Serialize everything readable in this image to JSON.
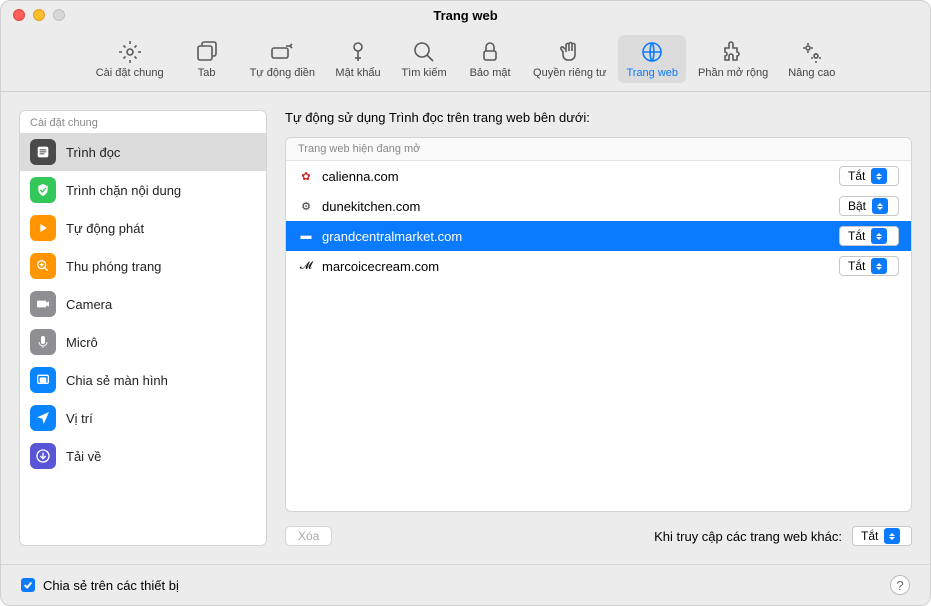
{
  "window": {
    "title": "Trang web"
  },
  "toolbar": {
    "items": [
      {
        "label": "Cài đặt chung",
        "icon": "gear"
      },
      {
        "label": "Tab",
        "icon": "tabs"
      },
      {
        "label": "Tự động điền",
        "icon": "autofill"
      },
      {
        "label": "Mật khẩu",
        "icon": "key"
      },
      {
        "label": "Tìm kiếm",
        "icon": "search"
      },
      {
        "label": "Bảo mật",
        "icon": "lock"
      },
      {
        "label": "Quyền riêng tư",
        "icon": "hand"
      },
      {
        "label": "Trang web",
        "icon": "globe"
      },
      {
        "label": "Phần mở rộng",
        "icon": "puzzle"
      },
      {
        "label": "Nâng cao",
        "icon": "gears"
      }
    ]
  },
  "sidebar": {
    "header": "Cài đặt chung",
    "items": [
      {
        "label": "Trình đọc",
        "color": "#4a4a4a",
        "icon": "reader"
      },
      {
        "label": "Trình chặn nội dung",
        "color": "#34c759",
        "icon": "shield"
      },
      {
        "label": "Tự động phát",
        "color": "#ff9500",
        "icon": "play"
      },
      {
        "label": "Thu phóng trang",
        "color": "#ff9500",
        "icon": "zoom"
      },
      {
        "label": "Camera",
        "color": "#8e8e93",
        "icon": "camera"
      },
      {
        "label": "Micrô",
        "color": "#8e8e93",
        "icon": "mic"
      },
      {
        "label": "Chia sẻ màn hình",
        "color": "#0a84ff",
        "icon": "screen"
      },
      {
        "label": "Vị trí",
        "color": "#0a84ff",
        "icon": "location"
      },
      {
        "label": "Tải về",
        "color": "#5856d6",
        "icon": "download"
      }
    ]
  },
  "main": {
    "title": "Tự động sử dụng Trình đọc trên trang web bên dưới:",
    "group_header": "Trang web hiện đang mở",
    "sites": [
      {
        "name": "calienna.com",
        "value": "Tắt",
        "favicon_color": "#d02020"
      },
      {
        "name": "dunekitchen.com",
        "value": "Bật",
        "favicon_color": "#333"
      },
      {
        "name": "grandcentralmarket.com",
        "value": "Tắt",
        "favicon_color": "#1a2a5a",
        "selected": true
      },
      {
        "name": "marcoicecream.com",
        "value": "Tắt",
        "favicon_color": "#000"
      }
    ],
    "delete_button": "Xóa",
    "other_sites_label": "Khi truy cập các trang web khác:",
    "other_sites_value": "Tắt"
  },
  "footer": {
    "share_label": "Chia sẻ trên các thiết bị"
  }
}
